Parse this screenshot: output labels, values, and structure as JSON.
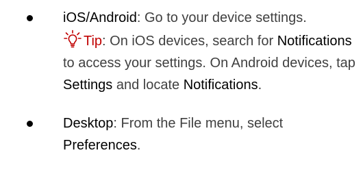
{
  "list": {
    "items": [
      {
        "term": "iOS/Android",
        "text": ": Go to your device settings.",
        "tip": {
          "icon": "lightbulb-icon",
          "label": "Tip",
          "text_1": ": On iOS devices, search for ",
          "term_1": "Notifications",
          "text_2": " to access your settings. On Android devices, tap ",
          "term_2": "Settings",
          "text_3": " and locate ",
          "term_3": "Notifications",
          "text_4": "."
        }
      },
      {
        "term": "Desktop",
        "text_1": ": From the File menu, select ",
        "term_2": "Preferences",
        "text_2": "."
      }
    ]
  },
  "colors": {
    "body_text": "#404040",
    "term_text": "#000000",
    "tip_accent": "#c00000"
  }
}
